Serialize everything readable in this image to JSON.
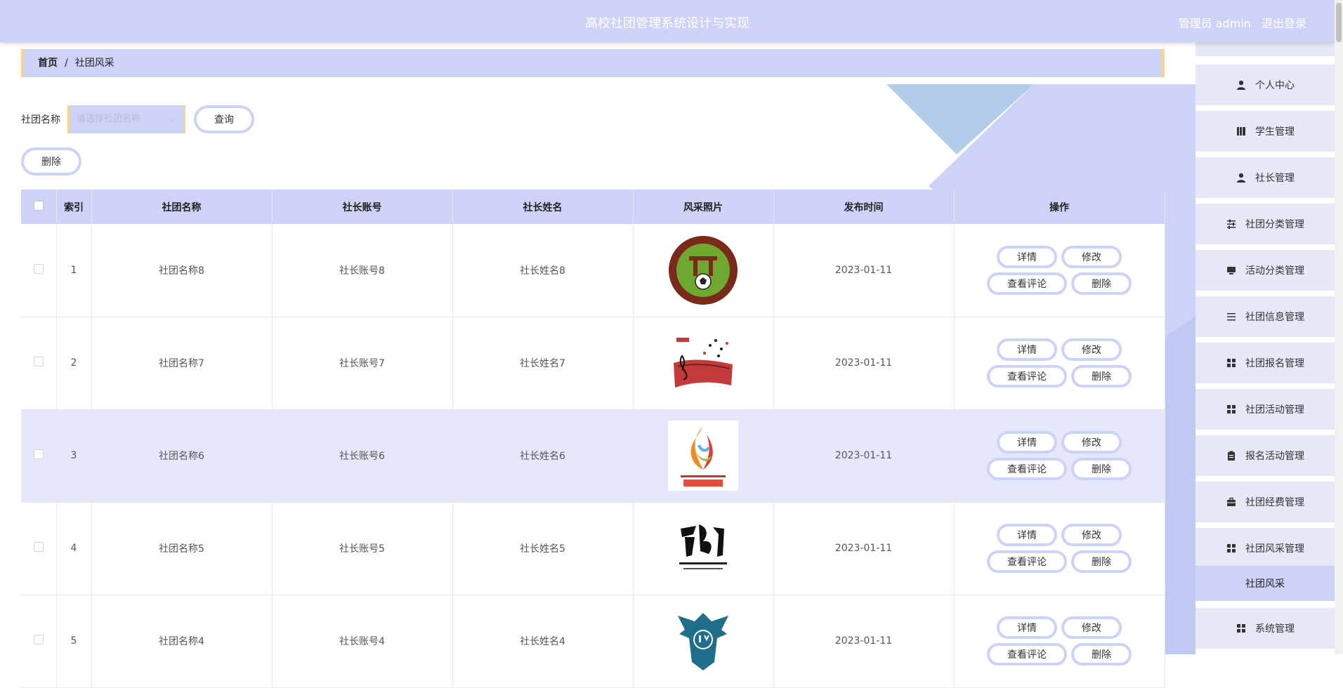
{
  "header": {
    "title": "高校社团管理系统设计与实现",
    "user_role": "管理员 admin",
    "logout": "退出登录"
  },
  "breadcrumb": {
    "home": "首页",
    "separator": "/",
    "current": "社团风采"
  },
  "search": {
    "label": "社团名称",
    "placeholder": "请选择社团名称",
    "query_button": "查询"
  },
  "toolbar": {
    "delete_button": "删除"
  },
  "table": {
    "headers": [
      "索引",
      "社团名称",
      "社长账号",
      "社长姓名",
      "风采照片",
      "发布时间",
      "操作"
    ],
    "rows": [
      {
        "index": "1",
        "name": "社团名称8",
        "account": "社长账号8",
        "leader": "社长姓名8",
        "photo": "football-association-logo",
        "date": "2023-01-11"
      },
      {
        "index": "2",
        "name": "社团名称7",
        "account": "社长账号7",
        "leader": "社长姓名7",
        "photo": "music-notes-image",
        "date": "2023-01-11"
      },
      {
        "index": "3",
        "name": "社团名称6",
        "account": "社长账号6",
        "leader": "社长姓名6",
        "photo": "art-federation-logo",
        "date": "2023-01-11"
      },
      {
        "index": "4",
        "name": "社团名称5",
        "account": "社长账号5",
        "leader": "社长姓名5",
        "photo": "calligraphy-society-logo",
        "date": "2023-01-11"
      },
      {
        "index": "5",
        "name": "社团名称4",
        "account": "社长账号4",
        "leader": "社长姓名4",
        "photo": "eagle-jy-logo",
        "date": "2023-01-11"
      }
    ],
    "actions": {
      "detail": "详情",
      "edit": "修改",
      "comments": "查看评论",
      "delete": "删除"
    }
  },
  "sidebar": {
    "items": [
      {
        "label": "个人中心",
        "icon": "user-icon"
      },
      {
        "label": "学生管理",
        "icon": "book-icon"
      },
      {
        "label": "社长管理",
        "icon": "user-icon"
      },
      {
        "label": "社团分类管理",
        "icon": "sliders-icon"
      },
      {
        "label": "活动分类管理",
        "icon": "monitor-icon"
      },
      {
        "label": "社团信息管理",
        "icon": "list-icon"
      },
      {
        "label": "社团报名管理",
        "icon": "grid-icon"
      },
      {
        "label": "社团活动管理",
        "icon": "grid-icon"
      },
      {
        "label": "报名活动管理",
        "icon": "clipboard-icon"
      },
      {
        "label": "社团经费管理",
        "icon": "briefcase-icon"
      },
      {
        "label": "社团风采管理",
        "icon": "grid-icon"
      }
    ],
    "active_sub": "社团风采",
    "last": {
      "label": "系统管理",
      "icon": "grid-icon"
    }
  },
  "colors": {
    "primary": "#cdd3f7",
    "accent": "#f8d488",
    "highlight_row": "#e5e8fc"
  }
}
